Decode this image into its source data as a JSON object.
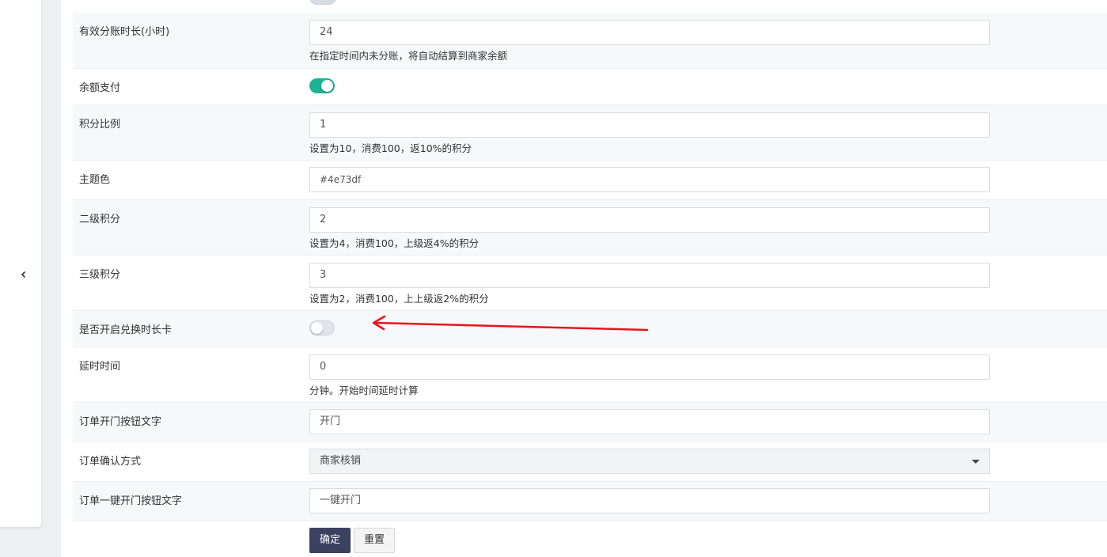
{
  "form": {
    "rows": [
      {
        "label": "有效分账时长(小时)",
        "value": "24",
        "hint": "在指定时间内未分账，将自动结算到商家余额"
      },
      {
        "label": "余额支付",
        "toggle": "on"
      },
      {
        "label": "积分比例",
        "value": "1",
        "hint": "设置为10，消费100，返10%的积分"
      },
      {
        "label": "主题色",
        "value": "#4e73df"
      },
      {
        "label": "二级积分",
        "value": "2",
        "hint": "设置为4，消费100，上级返4%的积分"
      },
      {
        "label": "三级积分",
        "value": "3",
        "hint": "设置为2，消费100，上上级返2%的积分"
      },
      {
        "label": "是否开启兑换时长卡",
        "toggle": "off"
      },
      {
        "label": "延时时间",
        "value": "0",
        "hint": "分钟。开始时间延时计算"
      },
      {
        "label": "订单开门按钮文字",
        "value": "开门"
      },
      {
        "label": "订单确认方式",
        "selected": "商家核销"
      },
      {
        "label": "订单一键开门按钮文字",
        "value": "一键开门"
      }
    ],
    "submit_label": "确定",
    "reset_label": "重置"
  },
  "colors": {
    "toggle_on": "#1cb394",
    "primary_button": "#3a4260",
    "annotation_arrow": "#e8141b"
  },
  "icons": {
    "sidebar_collapse": "chevron-left-icon"
  }
}
